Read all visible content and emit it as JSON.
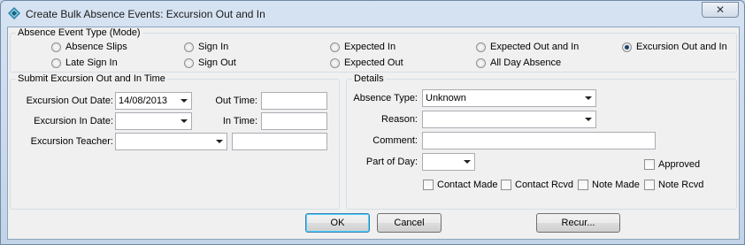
{
  "window": {
    "title": "Create Bulk Absence Events: Excursion Out and In",
    "close_glyph": "✕"
  },
  "mode": {
    "title": "Absence Event Type (Mode)",
    "options": [
      {
        "label": "Absence Slips",
        "selected": false
      },
      {
        "label": "Sign In",
        "selected": false
      },
      {
        "label": "Expected In",
        "selected": false
      },
      {
        "label": "Expected Out and In",
        "selected": false
      },
      {
        "label": "Excursion Out and In",
        "selected": true
      },
      {
        "label": "Late Sign In",
        "selected": false
      },
      {
        "label": "Sign Out",
        "selected": false
      },
      {
        "label": "Expected Out",
        "selected": false
      },
      {
        "label": "All Day Absence",
        "selected": false
      }
    ]
  },
  "submit": {
    "title": "Submit Excursion Out and In Time",
    "out_date_label": "Excursion Out Date:",
    "out_date_value": "14/08/2013",
    "in_date_label": "Excursion In Date:",
    "in_date_value": "",
    "teacher_label": "Excursion Teacher:",
    "teacher_value": "",
    "teacher_extra_value": "",
    "out_time_label": "Out Time:",
    "out_time_value": "",
    "in_time_label": "In Time:",
    "in_time_value": ""
  },
  "details": {
    "title": "Details",
    "absence_type_label": "Absence Type:",
    "absence_type_value": "Unknown",
    "reason_label": "Reason:",
    "reason_value": "",
    "comment_label": "Comment:",
    "comment_value": "",
    "part_of_day_label": "Part of Day:",
    "part_of_day_value": "",
    "approved_label": "Approved",
    "contact_made_label": "Contact Made",
    "contact_rcvd_label": "Contact Rcvd",
    "note_made_label": "Note Made",
    "note_rcvd_label": "Note Rcvd"
  },
  "buttons": {
    "ok": "OK",
    "cancel": "Cancel",
    "recur": "Recur..."
  }
}
